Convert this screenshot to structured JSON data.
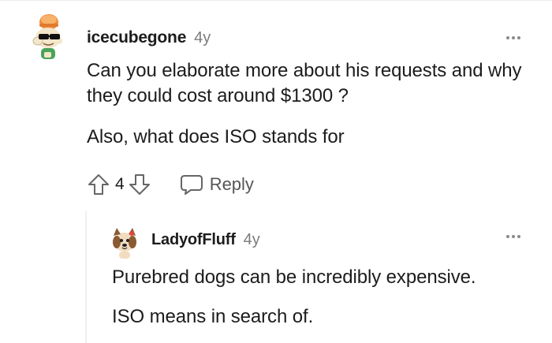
{
  "colors": {
    "text": "#1c1c1c",
    "meta": "#7c7c7c",
    "icon": "#666666",
    "thread_line": "#edeff1"
  },
  "comment": {
    "avatar": "snoo-avatar-sunglasses",
    "username": "icecubegone",
    "age": "4y",
    "paragraphs": [
      "Can you elaborate more about his requests and why they could cost around $1300 ?",
      "Also, what does ISO stands for"
    ],
    "score": "4",
    "reply_label": "Reply",
    "icons": {
      "upvote": "arrow-up-icon",
      "downvote": "arrow-down-icon",
      "reply": "speech-bubble-icon",
      "more": "more-options-icon"
    }
  },
  "reply": {
    "avatar": "snoo-avatar-dog",
    "username": "LadyofFluff",
    "age": "4y",
    "paragraphs": [
      "Purebred dogs can be incredibly expensive.",
      "ISO means in search of."
    ]
  }
}
